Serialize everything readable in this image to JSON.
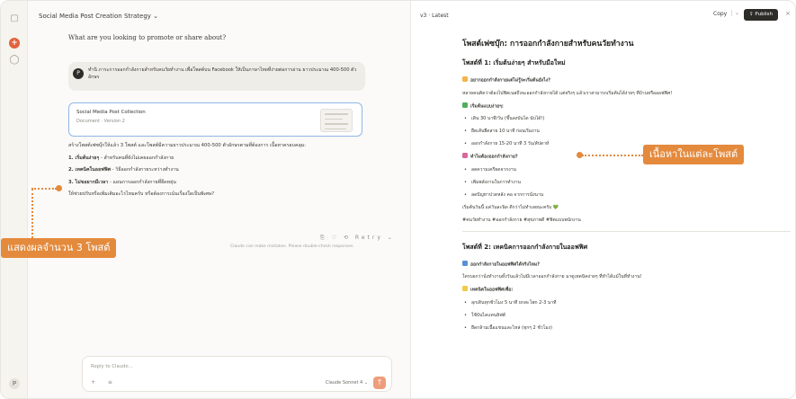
{
  "chat": {
    "title": "Social Media Post Creation Strategy ⌄",
    "question": "What are you looking to promote or share about?",
    "user_avatar": "P",
    "user_message": "ทำนิ ภาระการออกกำลังกายสำหรับคนวัยทำงาน เพื่อโพสต์บน Facebook ให้เป็นภาษาไทยที่ง่ายต่อการอ่าน ยาวประมาณ 400-500 ตัวอักษร",
    "doc_card": {
      "title": "Social Media Post Collection",
      "subtitle": "Document · Version 2"
    },
    "response": {
      "intro": "สร้างโพสต์เฟซบุ๊กให้แล้ว 3 โพสต์ และโพสต์มีความยาวประมาณ 400-500 ตัวอักษรตามที่ต้องการ เนื้อหาครอบคลุม:",
      "points": [
        {
          "bold": "1. เริ่มต้นง่ายๆ",
          "text": " - สำหรับคนที่ยังไม่เคยออกกำลังกาย"
        },
        {
          "bold": "2. เทคนิคในออฟฟิศ",
          "text": " - วิธีออกกำลังกายระหว่างทำงาน"
        },
        {
          "bold": "3. ไม่ขอยากมีเวลา",
          "text": " - แผนการออกกำลังกายที่ยืดหยุ่น"
        }
      ],
      "outro": "ให้ช่วยปรับหรือเพิ่มเติมอะไรไหมครับ หรือต้องการเน้นเรื่องใดเป็นพิเศษ?"
    },
    "actions": "⎘ ♡ ⟲ Retry ⌄",
    "disclaimer": "Claude can make mistakes. Please double-check responses.",
    "reply_placeholder": "Reply to Claude...",
    "reply_tools": "+ ≡",
    "model_label": "Claude Sonnet 4 ⌄",
    "send_icon": "↑"
  },
  "artifact": {
    "version": "v3 · Latest",
    "copy_label": "Copy",
    "chevron": "⌄",
    "publish_label": "⇪ Publish",
    "close": "×",
    "doc_title": "โพสต์เฟซบุ๊ก: การออกกำลังกายสำหรับคนวัยทำงาน",
    "post1": {
      "heading": "โพสต์ที่ 1: เริ่มต้นง่ายๆ สำหรับมือใหม่",
      "hook": "อยากออกกำลังกายแต่ไม่รู้จะเริ่มต้นยังไง?",
      "intro": "หลายคนคิดว่าต้องไปฟิตเนสถึงจะออกกำลังกายได้ แต่จริงๆ แล้วเราสามารถเริ่มต้นได้ง่ายๆ ที่บ้านหรือออฟฟิศ!",
      "list1_title": "เริ่มต้นแบบง่ายๆ:",
      "list1": [
        "เดิน 30 นาที/วัน (ขึ้นลงบันได นับได้!)",
        "ยืดเส้นยืดสาย 10 นาที ก่อนเริ่มงาน",
        "ออกกำลังกาย 15-20 นาที 3 วัน/สัปดาห์"
      ],
      "list2_title": "ทำไมต้องออกกำลังกาย?",
      "list2": [
        "ลดความเครียดจากงาน",
        "เพิ่มพลังงานในการทำงาน",
        "ลดปัญหาปวดหลัง คอ จากการนั่งนาน"
      ],
      "closing": "เริ่มต้นวันนี้ แค่วันละนิด ดีกว่าไม่ทำเลยนะครับ 💚",
      "tags": "#คนวัยทำงาน #ออกกำลังกาย #สุขภาพดี #ฟิตแบบพนักงาน"
    },
    "post2": {
      "heading": "โพสต์ที่ 2: เทคนิคการออกกำลังกายในออฟฟิศ",
      "hook": "ออกกำลังกายในออฟฟิศได้จริงไหม?",
      "intro": "ใครบอกว่านั่งทำงานทั้งวันแล้วไม่มีเวลาออกกำลังกาย มาดูเทคนิคง่ายๆ ที่ทำได้แม้ในที่ทำงาน!",
      "list_title": "เทคนิคในออฟฟิศเพื่อ:",
      "list": [
        "ลุกเดินทุกชั่วโมง 5 นาที ยกสะโพก 2-3 นาที",
        "ใช้บันไดแทนลิฟต์",
        "ยืดกล้ามเนื้อแขนและไหล่ (ทุกๆ 2 ชั่วโมง)"
      ]
    }
  },
  "callouts": {
    "left": "แสดงผลจำนวน 3 โพสต์",
    "right": "เนื้อหาในแต่ละโพสต์"
  },
  "colors": {
    "accent": "#e48a3d",
    "claude_orange": "#e2623d",
    "card_border": "#8fb7e6"
  }
}
